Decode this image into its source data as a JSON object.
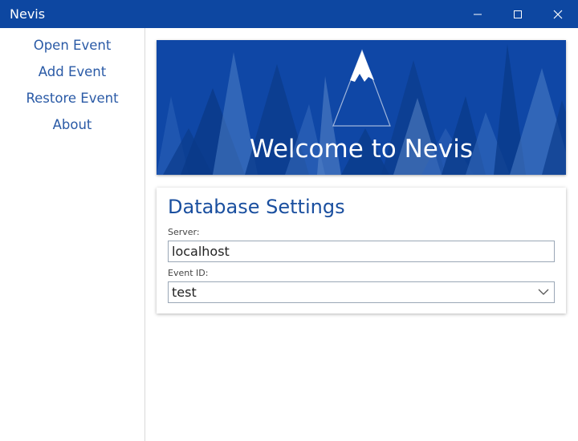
{
  "window": {
    "title": "Nevis",
    "controls": [
      "minimize-icon",
      "maximize-icon",
      "close-icon"
    ]
  },
  "sidebar": {
    "items": [
      {
        "label": "Open Event"
      },
      {
        "label": "Add Event"
      },
      {
        "label": "Restore Event"
      },
      {
        "label": "About"
      }
    ]
  },
  "banner": {
    "title": "Welcome to Nevis",
    "logo_icon": "mountain-logo-icon"
  },
  "database_settings": {
    "title": "Database Settings",
    "server_label": "Server:",
    "server_value": "localhost",
    "event_label": "Event ID:",
    "event_value": "test"
  },
  "colors": {
    "accent": "#0d47a1",
    "link": "#2a5aa6"
  }
}
